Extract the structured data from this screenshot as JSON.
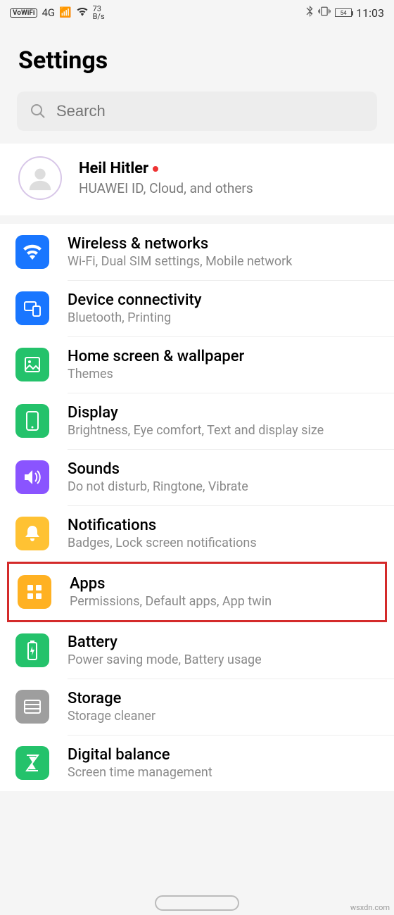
{
  "status_bar": {
    "vowifi": "VoWiFi",
    "network_label": "4G",
    "speed_value": "73",
    "speed_unit": "B/s",
    "battery_text": "54",
    "time": "11:03"
  },
  "header": {
    "title": "Settings"
  },
  "search": {
    "placeholder": "Search"
  },
  "profile": {
    "name": "Heil Hitler",
    "subtitle": "HUAWEI ID, Cloud, and others"
  },
  "items": [
    {
      "icon": "wifi-icon",
      "color": "ic-blue",
      "title": "Wireless & networks",
      "sub": "Wi-Fi, Dual SIM settings, Mobile network",
      "highlighted": false
    },
    {
      "icon": "devices-icon",
      "color": "ic-blue",
      "title": "Device connectivity",
      "sub": "Bluetooth, Printing",
      "highlighted": false
    },
    {
      "icon": "wallpaper-icon",
      "color": "ic-green",
      "title": "Home screen & wallpaper",
      "sub": "Themes",
      "highlighted": false
    },
    {
      "icon": "display-icon",
      "color": "ic-green",
      "title": "Display",
      "sub": "Brightness, Eye comfort, Text and display size",
      "highlighted": false
    },
    {
      "icon": "sound-icon",
      "color": "ic-purple",
      "title": "Sounds",
      "sub": "Do not disturb, Ringtone, Vibrate",
      "highlighted": false
    },
    {
      "icon": "bell-icon",
      "color": "ic-yellow",
      "title": "Notifications",
      "sub": "Badges, Lock screen notifications",
      "highlighted": false
    },
    {
      "icon": "apps-icon",
      "color": "ic-orange",
      "title": "Apps",
      "sub": "Permissions, Default apps, App twin",
      "highlighted": true
    },
    {
      "icon": "battery-icon",
      "color": "ic-green",
      "title": "Battery",
      "sub": "Power saving mode, Battery usage",
      "highlighted": false
    },
    {
      "icon": "storage-icon",
      "color": "ic-grey",
      "title": "Storage",
      "sub": "Storage cleaner",
      "highlighted": false
    },
    {
      "icon": "balance-icon",
      "color": "ic-green",
      "title": "Digital balance",
      "sub": "Screen time management",
      "highlighted": false
    }
  ],
  "watermark": "wsxdn.com"
}
